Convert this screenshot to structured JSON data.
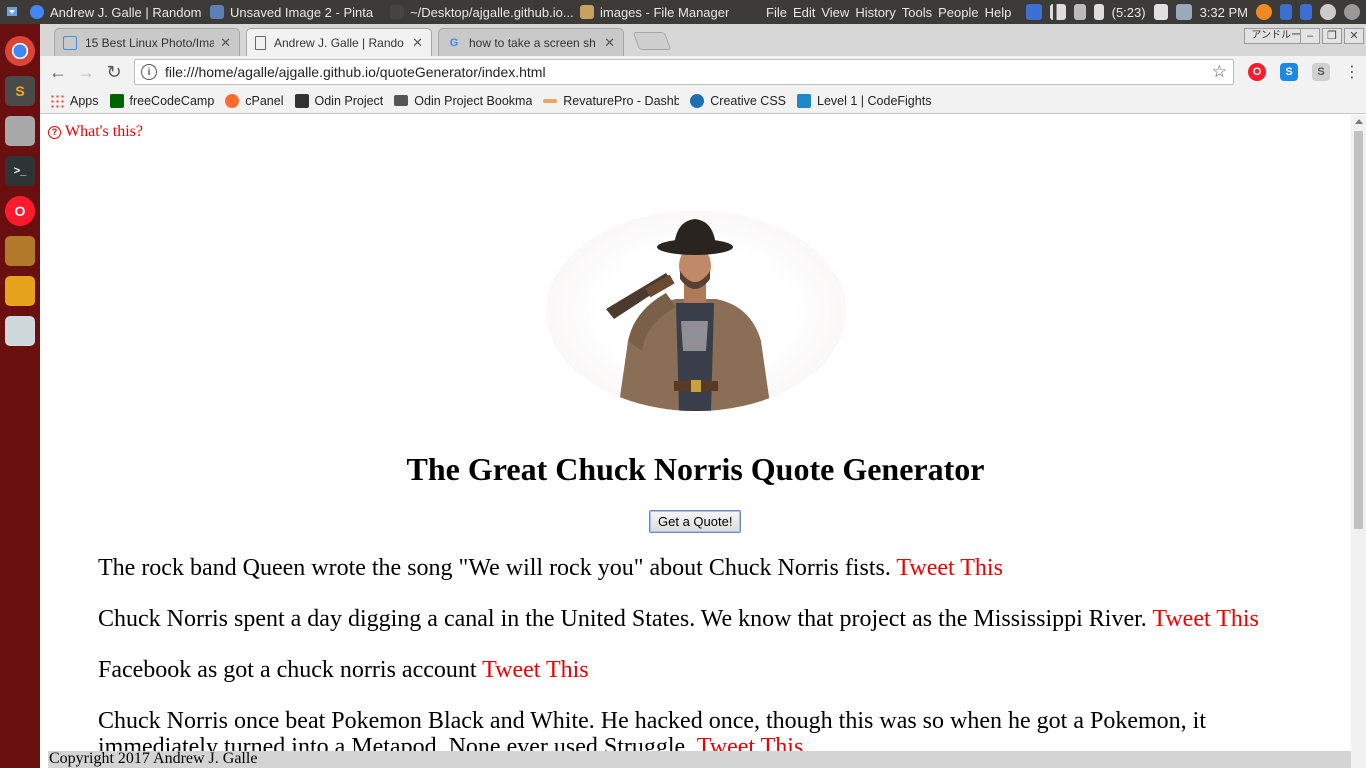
{
  "system_panel": {
    "taskbar": [
      {
        "label": "Andrew J. Galle | Random ...",
        "color": "#4285f4"
      },
      {
        "label": "Unsaved Image 2 - Pinta",
        "color": "#5d7fb8"
      },
      {
        "label": "~/Desktop/ajgalle.github.io...",
        "color": "#444444"
      },
      {
        "label": "images - File Manager",
        "color": "#c8a060"
      }
    ],
    "menu": [
      "File",
      "Edit",
      "View",
      "History",
      "Tools",
      "People",
      "Help"
    ],
    "battery": "(5:23)",
    "clock": "3:32 PM"
  },
  "dock": [
    {
      "name": "chrome-icon",
      "color": "#db4437",
      "glyph": ""
    },
    {
      "name": "sublime-icon",
      "color": "#4a4a4a",
      "glyph": "S"
    },
    {
      "name": "file-cabinet-icon",
      "color": "#9a9a9a",
      "glyph": ""
    },
    {
      "name": "terminal-icon",
      "color": "#2e3436",
      "glyph": ">_"
    },
    {
      "name": "opera-icon",
      "color": "#ff1b2d",
      "glyph": "O"
    },
    {
      "name": "archive-icon",
      "color": "#b07a2a",
      "glyph": ""
    },
    {
      "name": "presentation-icon",
      "color": "#e5a21c",
      "glyph": ""
    },
    {
      "name": "paint-icon",
      "color": "#cfd8dc",
      "glyph": ""
    }
  ],
  "browser": {
    "tabs": [
      {
        "label": "15 Best Linux Photo/Ima",
        "favicon": "image-icon"
      },
      {
        "label": "Andrew J. Galle | Rando",
        "favicon": "page-icon",
        "active": true
      },
      {
        "label": "how to take a screen sh",
        "favicon": "google-icon"
      }
    ],
    "ime_label": "アンドルー",
    "url": "file:///home/agalle/ajgalle.github.io/quoteGenerator/index.html",
    "bookmarks": [
      {
        "label": "Apps",
        "color": "#e94235"
      },
      {
        "label": "freeCodeCamp",
        "color": "#006400"
      },
      {
        "label": "cPanel",
        "color": "#ff6c2c"
      },
      {
        "label": "Odin Project",
        "color": "#333333"
      },
      {
        "label": "Odin Project Bookma",
        "color": "#555555"
      },
      {
        "label": "RevaturePro - Dashb",
        "color": "#f0a060"
      },
      {
        "label": "Creative CSS",
        "color": "#1e6fb0"
      },
      {
        "label": "Level 1 | CodeFights",
        "color": "#1e88c8"
      }
    ]
  },
  "page": {
    "whats_this": "What's this?",
    "title": "The Great Chuck Norris Quote Generator",
    "button_label": "Get a Quote!",
    "quotes": [
      {
        "text": "The rock band Queen wrote the song \"We will rock you\" about Chuck Norris fists.",
        "link": "Tweet This"
      },
      {
        "text": "Chuck Norris spent a day digging a canal in the United States. We know that project as the Mississippi River.",
        "link": "Tweet This"
      },
      {
        "text": "Facebook as got a chuck norris account",
        "link": "Tweet This"
      },
      {
        "text": "Chuck Norris once beat Pokemon Black and White. He hacked once, though this was so when he got a Pokemon, it immediately turned into a Metapod. None ever used Struggle.",
        "link": "Tweet This"
      }
    ],
    "footer": "Copyright 2017 Andrew J. Galle",
    "link_color": "#ee0000"
  }
}
